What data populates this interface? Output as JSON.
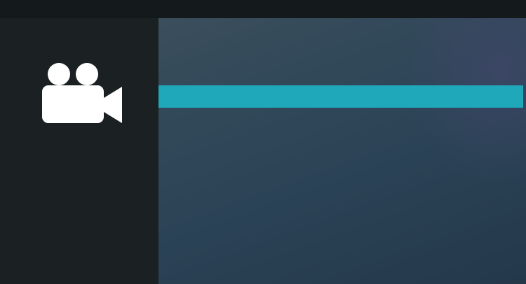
{
  "header": {
    "root_label": "",
    "separator": "",
    "current_label": "",
    "clock": ""
  },
  "left_panel": {
    "icon": "video-camera-icon",
    "caption": ""
  },
  "menu": {
    "items": [
      {
        "label": "",
        "selected": true
      },
      {
        "label": "",
        "selected": false
      },
      {
        "label": "",
        "selected": false
      },
      {
        "label": "",
        "selected": false
      },
      {
        "label": "",
        "selected": false
      },
      {
        "label": "",
        "selected": false
      }
    ]
  },
  "colors": {
    "accent_highlight": "#1fa7ba",
    "header_current": "#e0a522",
    "left_panel_bg": "#1b2122",
    "right_panel_bg": "#2f4758"
  }
}
